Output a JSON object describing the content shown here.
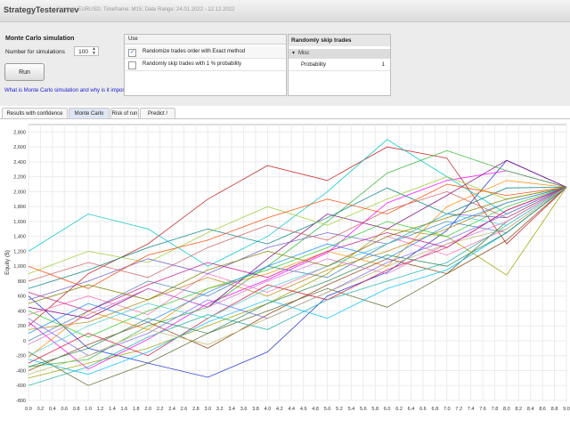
{
  "window": {
    "title": "StrategyTesterarrev",
    "subtitle": "Symbol: EURUSD; Timeframe: M15; Date Range: 24.01.2022 - 12.12.2022"
  },
  "monte_carlo": {
    "title": "Monte Carlo simulation",
    "num_simulations_label": "Number for simulations",
    "num_simulations_value": "100",
    "run_label": "Run",
    "help_link": "What is Monte Carlo simulation and why is it important?"
  },
  "use_panel": {
    "header": "Use",
    "rows": [
      {
        "checked": true,
        "check_mark": "✓",
        "label": "Randomize trades order with Exact method"
      },
      {
        "checked": false,
        "check_mark": "",
        "label": "Randomly skip trades with 1 % probability"
      }
    ]
  },
  "skip_panel": {
    "title": "Randomly skip trades",
    "group": "Misc",
    "group_marker": "▾",
    "property_label": "Probability",
    "property_value": "1"
  },
  "tabs": [
    {
      "label": "Results with confidence levels",
      "active": false
    },
    {
      "label": "Monte Carlo Chart",
      "active": true
    },
    {
      "label": "Risk of run",
      "active": false
    },
    {
      "label": "Predict / Verify",
      "active": false
    }
  ],
  "chart_data": {
    "type": "line",
    "ylabel": "Equity ($)",
    "xlabel": "",
    "xlim": [
      0,
      9
    ],
    "ylim": [
      -800,
      2900
    ],
    "x_ticks": [
      0.0,
      0.2,
      0.4,
      0.6,
      0.8,
      1.0,
      1.2,
      1.4,
      1.6,
      1.8,
      2.0,
      2.2,
      2.4,
      2.6,
      2.8,
      3.0,
      3.2,
      3.4,
      3.6,
      3.8,
      4.0,
      4.2,
      4.4,
      4.6,
      4.8,
      5.0,
      5.2,
      5.4,
      5.6,
      5.8,
      6.0,
      6.2,
      6.4,
      6.6,
      6.8,
      7.0,
      7.2,
      7.4,
      7.6,
      7.8,
      8.0,
      8.2,
      8.4,
      8.6,
      8.8,
      9.0
    ],
    "y_ticks": [
      -800,
      -600,
      -400,
      -200,
      0,
      200,
      400,
      600,
      800,
      1000,
      1200,
      1400,
      1600,
      1800,
      2000,
      2200,
      2400,
      2600,
      2800
    ],
    "x": [
      0,
      1,
      2,
      3,
      4,
      5,
      6,
      7,
      8,
      9
    ],
    "grid": true,
    "series": [
      {
        "color": "#ff00ff",
        "values": [
          250,
          -380,
          20,
          500,
          820,
          1180,
          1850,
          2150,
          2280,
          2060
        ]
      },
      {
        "color": "#1c2fd8",
        "values": [
          600,
          -100,
          -300,
          -490,
          -150,
          600,
          920,
          1480,
          2420,
          2060
        ]
      },
      {
        "color": "#c81e1e",
        "values": [
          200,
          900,
          1300,
          1900,
          2350,
          2150,
          2600,
          2450,
          1300,
          2060
        ]
      },
      {
        "color": "#2db52d",
        "values": [
          -350,
          -250,
          200,
          450,
          1000,
          1600,
          2250,
          2550,
          2280,
          2060
        ]
      },
      {
        "color": "#00c8c8",
        "values": [
          1200,
          1700,
          1500,
          1000,
          1400,
          2000,
          2700,
          2200,
          1700,
          2060
        ]
      },
      {
        "color": "#a0a000",
        "values": [
          -500,
          -300,
          -100,
          200,
          500,
          900,
          1500,
          1400,
          880,
          2060
        ]
      },
      {
        "color": "#ff8c00",
        "values": [
          -220,
          400,
          150,
          700,
          900,
          1200,
          1000,
          1800,
          2150,
          2060
        ]
      },
      {
        "color": "#800080",
        "values": [
          450,
          300,
          700,
          450,
          1100,
          1700,
          1500,
          1950,
          2420,
          2060
        ]
      },
      {
        "color": "#008080",
        "values": [
          700,
          950,
          1250,
          1500,
          1300,
          1650,
          2050,
          1700,
          2050,
          2060
        ]
      },
      {
        "color": "#556b2f",
        "values": [
          -150,
          -600,
          -300,
          100,
          400,
          700,
          450,
          900,
          1600,
          2060
        ]
      },
      {
        "color": "#ff69b4",
        "values": [
          350,
          600,
          350,
          900,
          650,
          1000,
          1400,
          1150,
          1500,
          2060
        ]
      },
      {
        "color": "#4682b4",
        "values": [
          0,
          400,
          800,
          600,
          1000,
          850,
          1300,
          1600,
          1450,
          2060
        ]
      },
      {
        "color": "#8b4513",
        "values": [
          -400,
          -50,
          250,
          -100,
          350,
          750,
          1100,
          900,
          1350,
          2060
        ]
      },
      {
        "color": "#9acd32",
        "values": [
          900,
          1200,
          1050,
          1450,
          1800,
          1550,
          1900,
          2200,
          1900,
          2060
        ]
      },
      {
        "color": "#dc143c",
        "values": [
          -300,
          100,
          -200,
          300,
          750,
          550,
          950,
          1250,
          1750,
          2060
        ]
      },
      {
        "color": "#6a5acd",
        "values": [
          550,
          800,
          1100,
          900,
          1250,
          1450,
          1300,
          1700,
          1650,
          2060
        ]
      },
      {
        "color": "#20b2aa",
        "values": [
          -600,
          -350,
          50,
          350,
          150,
          550,
          800,
          1050,
          1550,
          2060
        ]
      },
      {
        "color": "#b8860b",
        "values": [
          150,
          250,
          550,
          850,
          600,
          950,
          1200,
          1500,
          1850,
          2060
        ]
      },
      {
        "color": "#00bfff",
        "values": [
          -250,
          -450,
          -150,
          250,
          550,
          300,
          700,
          950,
          1450,
          2060
        ]
      },
      {
        "color": "#ff4500",
        "values": [
          1000,
          700,
          1150,
          1350,
          1650,
          1900,
          1700,
          2100,
          1950,
          2060
        ]
      },
      {
        "color": "#32cd32",
        "values": [
          400,
          50,
          400,
          700,
          950,
          1250,
          1600,
          1400,
          1800,
          2060
        ]
      },
      {
        "color": "#da70d6",
        "values": [
          -50,
          350,
          700,
          450,
          800,
          1100,
          900,
          1300,
          1600,
          2060
        ]
      },
      {
        "color": "#7b68ee",
        "values": [
          300,
          -200,
          100,
          550,
          300,
          650,
          1050,
          1350,
          1700,
          2060
        ]
      },
      {
        "color": "#2e8b57",
        "values": [
          -350,
          -100,
          300,
          100,
          500,
          800,
          1150,
          1000,
          1450,
          2060
        ]
      },
      {
        "color": "#cd5c5c",
        "values": [
          800,
          1050,
          850,
          1250,
          1550,
          1350,
          1750,
          2000,
          1650,
          2060
        ]
      },
      {
        "color": "#1e90ff",
        "values": [
          100,
          500,
          250,
          650,
          1000,
          1300,
          1100,
          1550,
          1850,
          2060
        ]
      },
      {
        "color": "#bdb76b",
        "values": [
          -450,
          -200,
          150,
          -50,
          300,
          650,
          1000,
          1300,
          1500,
          2060
        ]
      },
      {
        "color": "#c71585",
        "values": [
          650,
          400,
          750,
          1050,
          850,
          1200,
          1450,
          1250,
          1750,
          2060
        ]
      },
      {
        "color": "#48d1cc",
        "values": [
          -200,
          200,
          500,
          300,
          700,
          1000,
          1300,
          1700,
          1550,
          2060
        ]
      },
      {
        "color": "#808000",
        "values": [
          500,
          750,
          550,
          950,
          1200,
          1000,
          1400,
          1650,
          1900,
          2060
        ]
      }
    ]
  }
}
